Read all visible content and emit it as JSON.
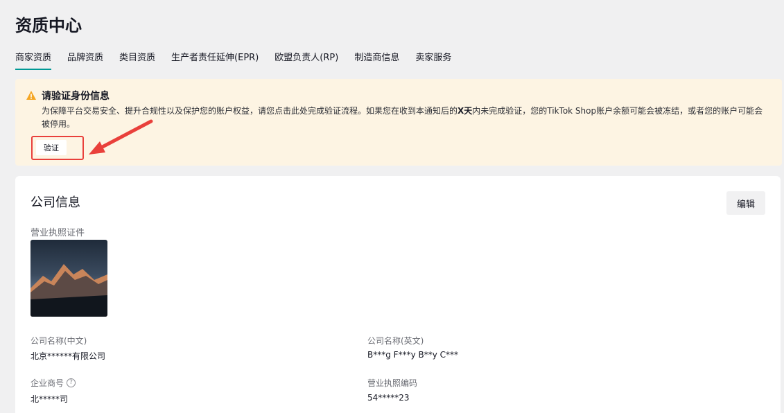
{
  "page": {
    "title": "资质中心"
  },
  "tabs": [
    {
      "label": "商家资质",
      "active": true
    },
    {
      "label": "品牌资质"
    },
    {
      "label": "类目资质"
    },
    {
      "label": "生产者责任延伸(EPR)"
    },
    {
      "label": "欧盟负责人(RP)"
    },
    {
      "label": "制造商信息"
    },
    {
      "label": "卖家服务"
    }
  ],
  "alert": {
    "icon": "warning-icon",
    "title": "请验证身份信息",
    "text_before": "为保障平台交易安全、提升合规性以及保护您的账户权益，请您点击此处完成验证流程。如果您在收到本通知后的",
    "text_bold": "X天",
    "text_after": "内未完成验证，您的TikTok Shop账户余额可能会被冻结，或者您的账户可能会被停用。",
    "verify_label": "验证",
    "highlight_color": "#e9403b"
  },
  "company": {
    "title": "公司信息",
    "edit_label": "编辑",
    "license_label": "营业执照证件",
    "fields": {
      "name_cn_label": "公司名称(中文)",
      "name_cn_value": "北京******有限公司",
      "name_en_label": "公司名称(英文)",
      "name_en_value": "B***g F***y B**y C***",
      "trade_name_label": "企业商号",
      "trade_name_value": "北*****司",
      "license_no_label": "营业执照编码",
      "license_no_value": "54*****23"
    }
  },
  "colors": {
    "accent": "#009995",
    "alert_bg": "#fdf4e3",
    "warning": "#f5a623"
  }
}
